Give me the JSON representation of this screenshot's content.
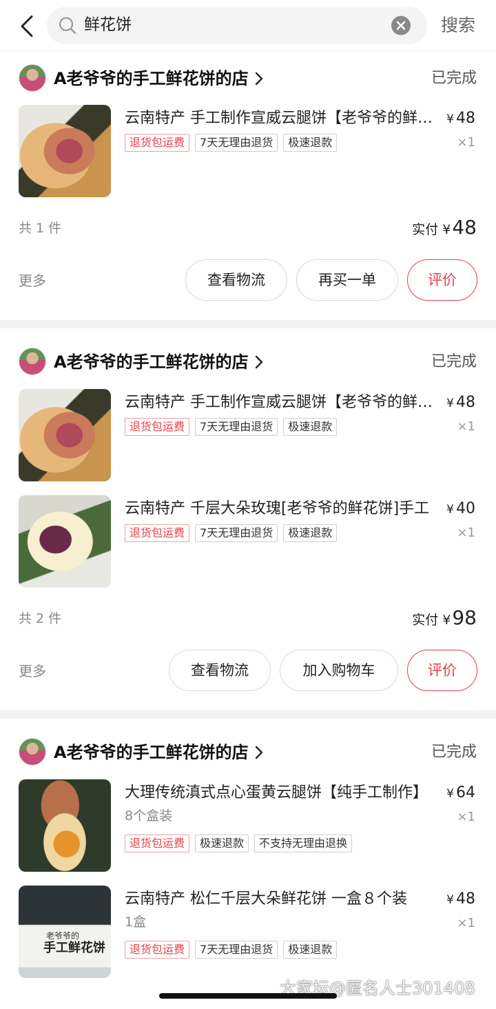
{
  "search": {
    "query": "鲜花饼",
    "button_label": "搜索"
  },
  "orders": [
    {
      "shop_name": "A老爷爷的手工鲜花饼的店",
      "status": "已完成",
      "items": [
        {
          "title": "云南特产 手工制作宣威云腿饼【老爷爷的鲜花饼】",
          "spec": "",
          "price": "48",
          "qty": "×1",
          "tags": [
            "退货包运费",
            "7天无理由退货",
            "极速退款"
          ]
        }
      ],
      "count_text": "共 1 件",
      "paid_label": "实付",
      "paid_currency": "¥",
      "paid_amount": "48",
      "more_label": "更多",
      "actions": [
        "查看物流",
        "再买一单",
        "评价"
      ]
    },
    {
      "shop_name": "A老爷爷的手工鲜花饼的店",
      "status": "已完成",
      "items": [
        {
          "title": "云南特产 手工制作宣威云腿饼【老爷爷的鲜花饼】",
          "spec": "",
          "price": "48",
          "qty": "×1",
          "tags": [
            "退货包运费",
            "7天无理由退货",
            "极速退款"
          ]
        },
        {
          "title": "云南特产 千层大朵玫瑰[老爷爷的鲜花饼]手工",
          "spec": "",
          "price": "40",
          "qty": "×1",
          "tags": [
            "退货包运费",
            "7天无理由退货",
            "极速退款"
          ]
        }
      ],
      "count_text": "共 2 件",
      "paid_label": "实付",
      "paid_currency": "¥",
      "paid_amount": "98",
      "more_label": "更多",
      "actions": [
        "查看物流",
        "加入购物车",
        "评价"
      ]
    },
    {
      "shop_name": "A老爷爷的手工鲜花饼的店",
      "status": "已完成",
      "items": [
        {
          "title": "大理传统滇式点心蛋黄云腿饼【纯手工制作】",
          "spec": "8个盒装",
          "price": "64",
          "qty": "×1",
          "tags": [
            "退货包运费",
            "极速退款",
            "不支持无理由退换"
          ]
        },
        {
          "title": "云南特产 松仁千层大朵鲜花饼  一盒８个装",
          "spec": "1盒",
          "price": "48",
          "qty": "×1",
          "tags": [
            "退货包运费",
            "7天无理由退货",
            "极速退款"
          ]
        }
      ],
      "box_text": {
        "line1": "老爷爷的",
        "line2": "手工鲜花饼"
      }
    }
  ],
  "price_currency": "¥",
  "watermark": "大家坛@匿名人士301408",
  "colors": {
    "accent_red": "#e5404a",
    "separator": "#f2f2f2"
  }
}
